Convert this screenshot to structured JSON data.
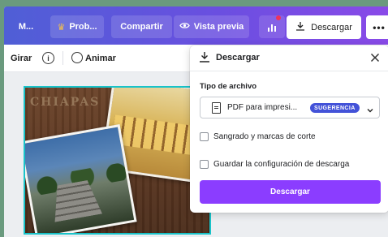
{
  "toolbar": {
    "menu_label": "M...",
    "pro_label": "Prob...",
    "pro_icon": "crown-icon",
    "share_label": "Compartir",
    "preview_label": "Vista previa",
    "preview_icon": "eye-icon",
    "insights_icon": "bar-chart-icon",
    "download_label": "Descargar",
    "more_label": "•••",
    "notification_color": "#f0325a"
  },
  "subtoolbar": {
    "flip_label": "Girar",
    "info_icon_glyph": "i",
    "animate_label": "Animar"
  },
  "canvas": {
    "design_text": "CHIAPAS",
    "selection_color": "#19c3c9"
  },
  "download_panel": {
    "title": "Descargar",
    "file_type_label": "Tipo de archivo",
    "file_type_value": "PDF para impresi...",
    "suggestion_badge": "SUGERENCIA",
    "bleed_option": "Sangrado y marcas de corte",
    "bleed_checked": false,
    "save_settings_option": "Guardar la configuración de descarga",
    "save_settings_checked": false,
    "download_button": "Descargar",
    "accent_color": "#8b3dff"
  }
}
